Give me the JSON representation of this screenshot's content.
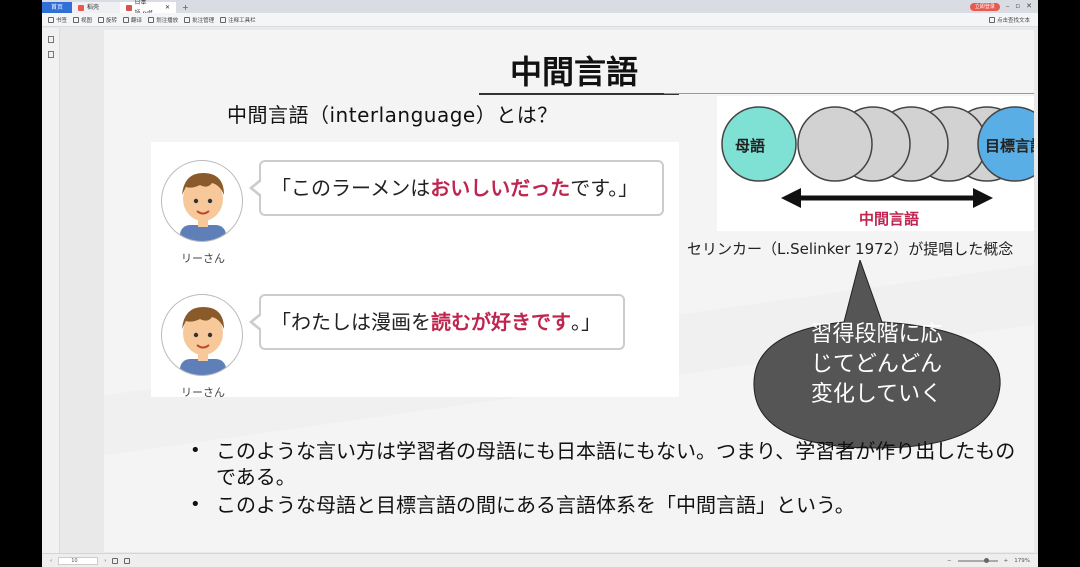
{
  "tabs": [
    {
      "label": "首页",
      "active": true
    },
    {
      "label": "稻壳",
      "icon_color": "#e85a4f"
    },
    {
      "label": "日本語.pdf",
      "icon_color": "#d9534f"
    }
  ],
  "titlebar": {
    "login": "立即登录",
    "minimize": "–",
    "maximize": "▫",
    "close": "✕"
  },
  "toolbar": {
    "items": [
      "书签",
      "视图",
      "旋转",
      "翻译",
      "划注播放",
      "批注管理",
      "注释工具栏"
    ],
    "right": "点击查找文本"
  },
  "slide": {
    "title": "中間言語",
    "subtitle": "中間言語（interlanguage）とは？",
    "dialogs": [
      {
        "speaker": "リーさん",
        "before": "「このラーメンは",
        "highlight": "おいしいだった",
        "after": "です。」"
      },
      {
        "speaker": "リーさん",
        "before": "「わたしは漫画を",
        "highlight": "読むが好きです",
        "after": "。」"
      }
    ],
    "diagram": {
      "left_label": "母語",
      "right_label": "目標言語",
      "arrow_label": "中間言語",
      "left_color": "#7fe0d4",
      "right_color": "#5aaee6",
      "mid_color": "#d2d2d2",
      "arrow_label_color": "#c0254f"
    },
    "caption": "セリンカー（L.Selinker 1972）が提唱した概念",
    "callout": {
      "line1": "習得段階に応",
      "line2": "じてどんどん",
      "line3": "変化していく",
      "color": "#555555"
    },
    "bullets": [
      "このような言い方は学習者の母語にも日本語にもない。つまり、学習者が作り出したものである。",
      "このような母語と目標言語の間にある言語体系を「中間言語」という。"
    ]
  },
  "statusbar": {
    "page": "10",
    "zoom": "179%"
  }
}
